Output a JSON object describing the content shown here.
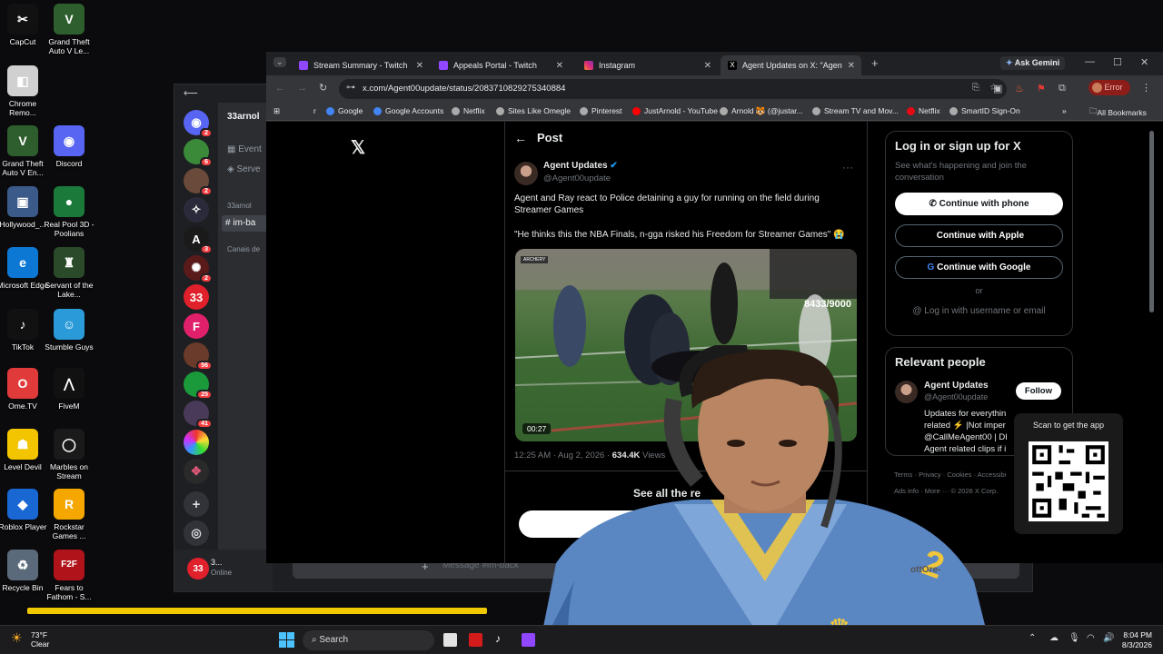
{
  "desktop": {
    "icons": [
      {
        "label": "CapCut",
        "color": "#111111",
        "glyph": "✂"
      },
      {
        "label": "Grand Theft Auto V Le...",
        "color": "#2e5e2e",
        "glyph": "V"
      },
      {
        "label": "Chrome Remo...",
        "color": "#d0d0d0",
        "glyph": "◧"
      },
      {
        "label": "Grand Theft Auto V En...",
        "color": "#2e5e2e",
        "glyph": "V"
      },
      {
        "label": "Discord",
        "color": "#5865f2",
        "glyph": "◉"
      },
      {
        "label": "Hollywood_...",
        "color": "#3b5a8a",
        "glyph": "▣"
      },
      {
        "label": "Real Pool 3D - Poolians",
        "color": "#1b7a3a",
        "glyph": "●"
      },
      {
        "label": "Microsoft Edge",
        "color": "#0c78d4",
        "glyph": "e"
      },
      {
        "label": "Servant of the Lake...",
        "color": "#2a4a2a",
        "glyph": "♜"
      },
      {
        "label": "TikTok",
        "color": "#111111",
        "glyph": "♪"
      },
      {
        "label": "Stumble Guys",
        "color": "#2a9ad8",
        "glyph": "☺"
      },
      {
        "label": "Ome.TV",
        "color": "#e03a3a",
        "glyph": "O"
      },
      {
        "label": "FiveM",
        "color": "#111111",
        "glyph": "⋀"
      },
      {
        "label": "Level Devil",
        "color": "#f2c500",
        "glyph": "☗"
      },
      {
        "label": "Marbles on Stream",
        "color": "#1a1a1a",
        "glyph": "◯"
      },
      {
        "label": "Roblox Player",
        "color": "#1967d2",
        "glyph": "◆"
      },
      {
        "label": "Rockstar Games ...",
        "color": "#f5a700",
        "glyph": "R"
      },
      {
        "label": "Recycle Bin",
        "color": "#5a6a7a",
        "glyph": "♻"
      },
      {
        "label": "Fears to Fathom - S...",
        "color": "#b0141a",
        "glyph": "F2F"
      }
    ]
  },
  "discord": {
    "server_name": "33arnol",
    "channel_events": "Event",
    "channel_server": "Serve",
    "category": "33arnol",
    "active_channel": "im-ba",
    "category2": "Canais de",
    "user_name": "3...",
    "user_status": "Online",
    "message_placeholder": "Message #im-back",
    "server_badges": [
      "2",
      "6",
      "2",
      "",
      "3",
      "2",
      "",
      "",
      "56",
      "25",
      "41",
      "",
      ""
    ],
    "server33": "33",
    "serverF": "F"
  },
  "chrome": {
    "tabs": [
      {
        "title": "Stream Summary - Twitch",
        "color": "#9146ff"
      },
      {
        "title": "Appeals Portal - Twitch",
        "color": "#9146ff"
      },
      {
        "title": "Instagram",
        "color": "#e1306c"
      },
      {
        "title": "Agent Updates on X: \"Agent an",
        "color": "#000000"
      }
    ],
    "ask_gemini": "Ask Gemini",
    "url": "x.com/Agent00update/status/2083710829275340884",
    "error_label": "Error",
    "bookmarks": [
      {
        "label": "Google",
        "color": "#4285f4"
      },
      {
        "label": "Google Accounts",
        "color": "#4285f4"
      },
      {
        "label": "Netflix",
        "color": "#aaaaaa"
      },
      {
        "label": "Sites Like Omegle",
        "color": "#aaaaaa"
      },
      {
        "label": "Pinterest",
        "color": "#aaaaaa"
      },
      {
        "label": "JustArnold - YouTube",
        "color": "#ff0000"
      },
      {
        "label": "Arnold 🐯 (@justar...",
        "color": "#aaaaaa"
      },
      {
        "label": "Stream TV and Mov...",
        "color": "#aaaaaa"
      },
      {
        "label": "Netflix",
        "color": "#e50914"
      },
      {
        "label": "SmartID Sign-On",
        "color": "#aaaaaa"
      }
    ],
    "all_bookmarks": "All Bookmarks"
  },
  "post": {
    "header": "Post",
    "author_name": "Agent Updates",
    "author_handle": "@Agent00update",
    "text1": "Agent and Ray react to Police detaining a guy for running on the field during Streamer Games",
    "text2": "\"He thinks this the NBA Finals, n-gga risked his Freedom for Streamer Games\" 😭",
    "video_time": "00:27",
    "video_overlay_counter": "8433/9000",
    "video_overlay_tag": "ARCHERY",
    "timestamp": "12:25 AM · Aug 2, 2026 ·",
    "views_count": "634.4K",
    "views_label": "Views",
    "see_all": "See all the re"
  },
  "sidebar": {
    "login_title": "Log in or sign up for X",
    "login_sub": "See what's happening and join the conversation",
    "btn_phone": "Continue with phone",
    "btn_apple": "Continue with Apple",
    "btn_google": "Continue with Google",
    "or": "or",
    "btn_username": "Log in with username or email",
    "relevant_title": "Relevant people",
    "rp_name": "Agent Updates",
    "rp_handle": "@Agent00update",
    "rp_follow": "Follow",
    "rp_bio1": "Updates for everythin",
    "rp_bio2": "related ⚡ |Not imper",
    "rp_bio3": "@CallMeAgent00 | DI",
    "rp_bio4": "Agent related clips if i",
    "footer1": "Terms · Privacy · Cookies · Accessibi",
    "footer2": "Ads info · More ··· © 2026 X Corp.",
    "qr_label": "Scan to get the app"
  },
  "taskbar": {
    "weather_temp": "73°F",
    "weather_desc": "Clear",
    "search": "Search",
    "time": "8:04 PM",
    "date": "8/3/2026"
  },
  "overlay_text": "ottOre-"
}
